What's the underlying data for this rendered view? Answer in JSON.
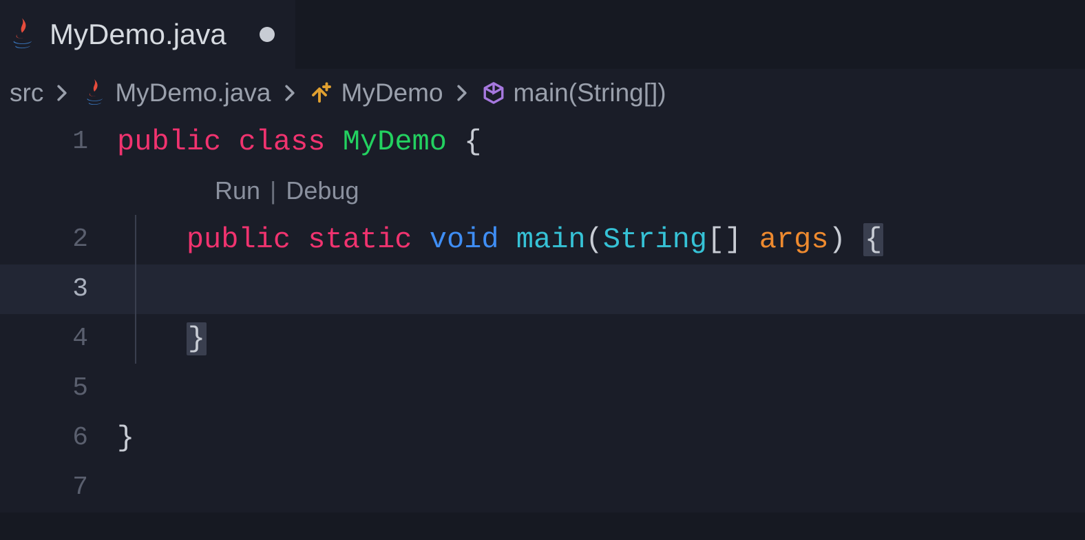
{
  "tab": {
    "filename": "MyDemo.java",
    "dirty": true
  },
  "breadcrumb": {
    "seg1": "src",
    "seg2": "MyDemo.java",
    "seg3": "MyDemo",
    "seg4": "main(String[])"
  },
  "codelens": {
    "run": "Run",
    "sep": "|",
    "debug": "Debug"
  },
  "lines": {
    "n1": "1",
    "n2": "2",
    "n3": "3",
    "n4": "4",
    "n5": "5",
    "n6": "6",
    "n7": "7"
  },
  "code": {
    "l1": {
      "kw_public": "public",
      "kw_class": "class",
      "cls": "MyDemo",
      "brace_open": "{"
    },
    "l2": {
      "kw_public": "public",
      "kw_static": "static",
      "kw_void": "void",
      "fn": "main",
      "paren_open": "(",
      "type": "String",
      "brackets": "[]",
      "arg": "args",
      "paren_close": ")",
      "brace_open": "{"
    },
    "l3": {
      "content": ""
    },
    "l4": {
      "brace_close": "}"
    },
    "l5": {
      "content": ""
    },
    "l6": {
      "brace_close": "}"
    },
    "l7": {
      "content": ""
    }
  }
}
